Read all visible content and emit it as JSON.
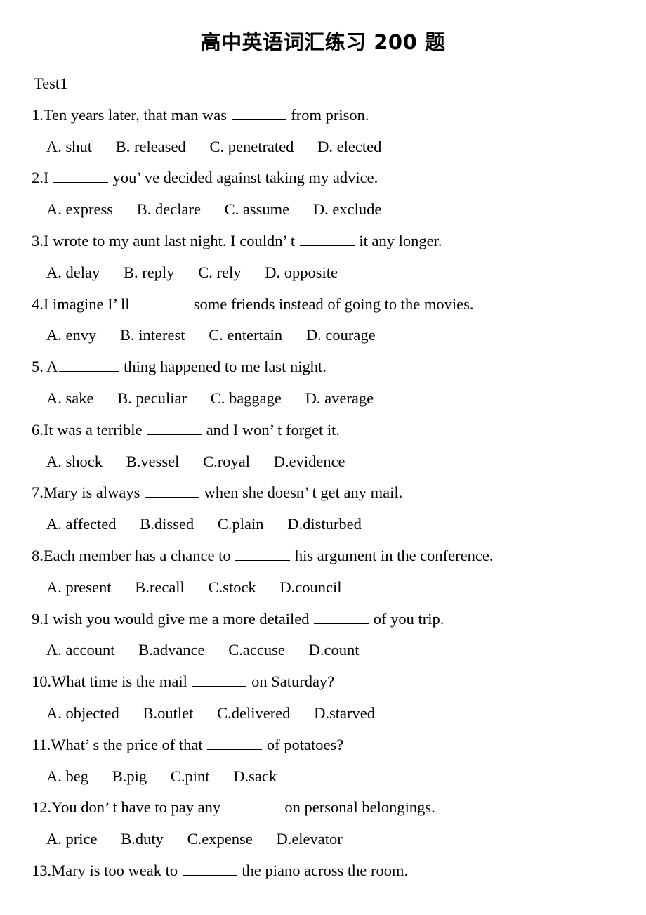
{
  "document": {
    "title": "高中英语词汇练习 200 题",
    "section_label": "Test1"
  },
  "questions": [
    {
      "number": "1.",
      "text_before": "Ten years later, that man was ",
      "blank_width": 78,
      "text_after": " from prison.",
      "options_text": "A. shut   B. released   C. penetrated   D. elected",
      "options": [
        "A. shut",
        "B. released",
        "C. penetrated",
        "D. elected"
      ]
    },
    {
      "number": "2.",
      "text_before": "I ",
      "blank_width": 78,
      "text_after": " you’ ve decided against taking my advice.",
      "options_text": "A. express   B. declare   C. assume   D. exclude",
      "options": [
        "A. express",
        "B. declare",
        "C. assume",
        "D. exclude"
      ]
    },
    {
      "number": "3.",
      "text_before": "I wrote to my aunt last night. I couldn’ t ",
      "blank_width": 78,
      "text_after": " it any longer.",
      "options_text": "A. delay   B. reply   C. rely   D. opposite",
      "options": [
        "A. delay",
        "B. reply",
        "C. rely",
        "D. opposite"
      ]
    },
    {
      "number": "4.",
      "text_before": "I imagine I’ ll ",
      "blank_width": 78,
      "text_after": " some friends instead of going to the movies.",
      "options_text": "A. envy   B. interest   C. entertain   D. courage",
      "options": [
        "A. envy",
        "B. interest",
        "C. entertain",
        "D. courage"
      ]
    },
    {
      "number": "5.",
      "text_before": " A",
      "blank_width": 86,
      "text_after": " thing happened to me last night.",
      "options_text": "A. sake   B. peculiar   C. baggage   D. average",
      "options": [
        "A. sake",
        "B. peculiar",
        "C. baggage",
        "D. average"
      ]
    },
    {
      "number": "6.",
      "text_before": "It was a terrible ",
      "blank_width": 78,
      "text_after": " and I won’ t forget it.",
      "options_text": "A. shock   B.vessel   C.royal   D.evidence",
      "options": [
        "A. shock",
        "B.vessel",
        "C.royal",
        "D.evidence"
      ]
    },
    {
      "number": "7.",
      "text_before": "Mary is always ",
      "blank_width": 78,
      "text_after": " when she doesn’ t get any mail.",
      "options_text": "A. affected   B.dissed   C.plain   D.disturbed",
      "options": [
        "A. affected",
        "B.dissed",
        "C.plain",
        "D.disturbed"
      ]
    },
    {
      "number": "8.",
      "text_before": "Each member has a chance to ",
      "blank_width": 78,
      "text_after": " his argument in the conference.",
      "options_text": "A. present   B.recall   C.stock   D.council",
      "options": [
        "A. present",
        "B.recall",
        "C.stock",
        "D.council"
      ]
    },
    {
      "number": "9.",
      "text_before": "I wish you would give me a more detailed ",
      "blank_width": 78,
      "text_after": " of you trip.",
      "options_text": "A. account   B.advance   C.accuse   D.count",
      "options": [
        "A. account",
        "B.advance",
        "C.accuse",
        "D.count"
      ]
    },
    {
      "number": "10.",
      "text_before": "What time is the mail ",
      "blank_width": 78,
      "text_after": " on Saturday?",
      "options_text": "A. objected   B.outlet   C.delivered   D.starved",
      "options": [
        "A. objected",
        "B.outlet",
        "C.delivered",
        "D.starved"
      ]
    },
    {
      "number": "11.",
      "text_before": "What’ s the price of that ",
      "blank_width": 78,
      "text_after": " of potatoes?",
      "options_text": "A. beg   B.pig   C.pint   D.sack",
      "options": [
        "A. beg",
        "B.pig",
        "C.pint",
        "D.sack"
      ]
    },
    {
      "number": "12.",
      "text_before": "You don’ t have to pay any ",
      "blank_width": 78,
      "text_after": " on personal belongings.",
      "options_text": "A. price   B.duty   C.expense   D.elevator",
      "options": [
        "A. price",
        "B.duty",
        "C.expense",
        "D.elevator"
      ]
    },
    {
      "number": "13.",
      "text_before": "Mary is too weak to ",
      "blank_width": 78,
      "text_after": " the piano across the room.",
      "options_text": "",
      "options": []
    }
  ]
}
